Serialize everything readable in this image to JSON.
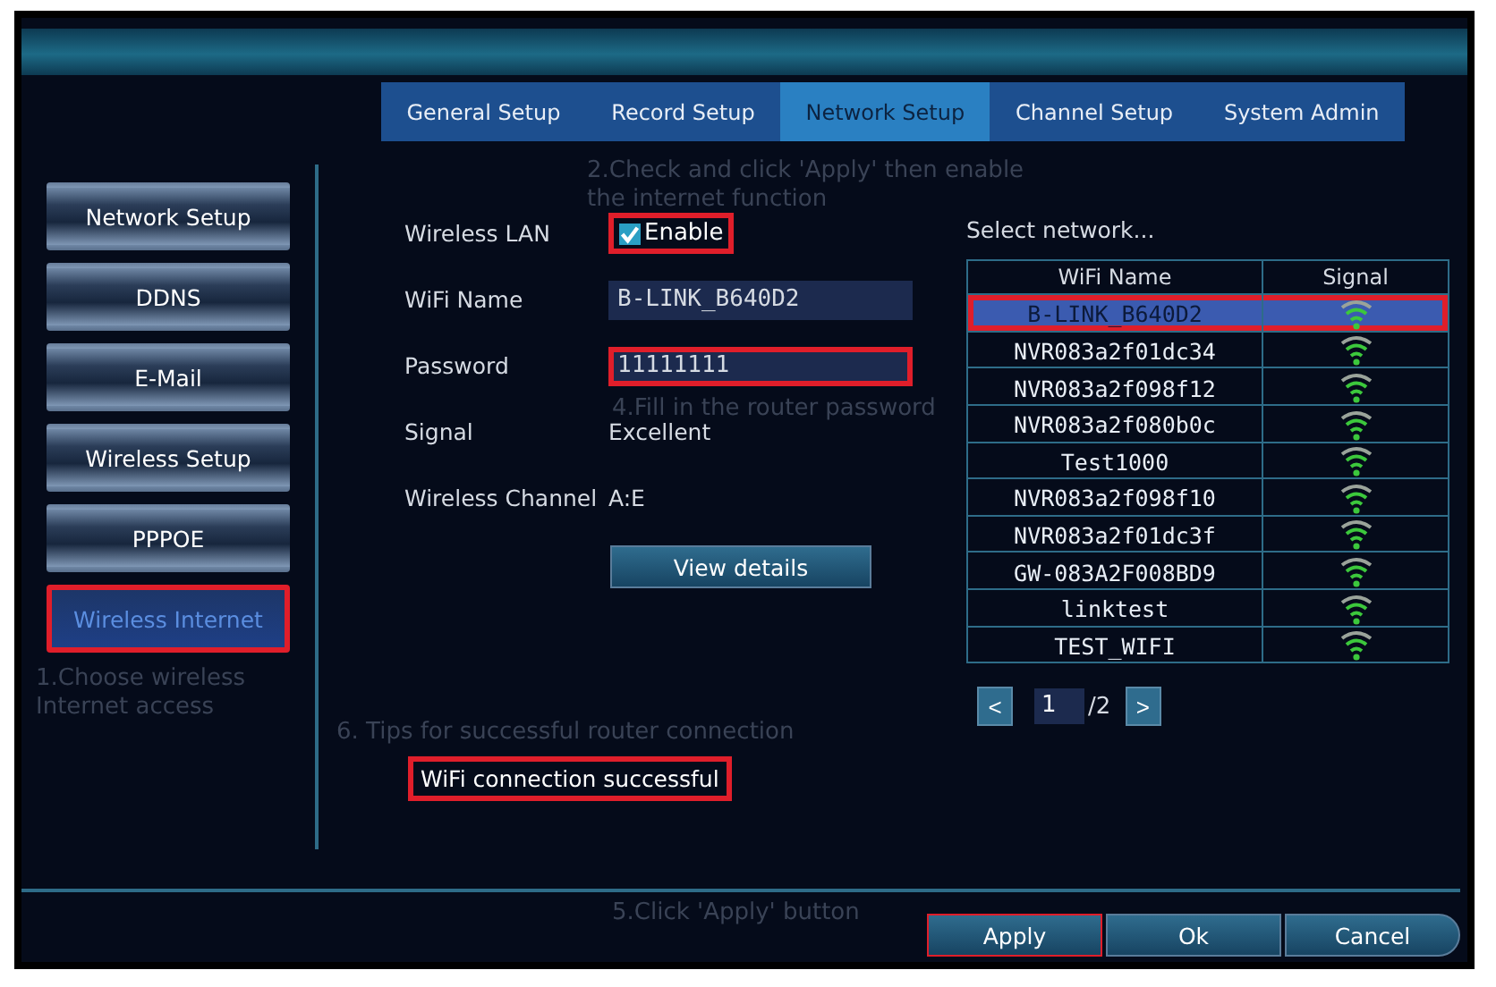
{
  "tabs": [
    {
      "label": "General Setup",
      "selected": false
    },
    {
      "label": "Record Setup",
      "selected": false
    },
    {
      "label": "Network Setup",
      "selected": true
    },
    {
      "label": "Channel Setup",
      "selected": false
    },
    {
      "label": "System Admin",
      "selected": false
    }
  ],
  "sidebar": {
    "items": [
      {
        "label": "Network Setup",
        "selected": false,
        "highlighted": false
      },
      {
        "label": "DDNS",
        "selected": false,
        "highlighted": false
      },
      {
        "label": "E-Mail",
        "selected": false,
        "highlighted": false
      },
      {
        "label": "Wireless Setup",
        "selected": false,
        "highlighted": false
      },
      {
        "label": "PPPOE",
        "selected": false,
        "highlighted": false
      },
      {
        "label": "Wireless Internet",
        "selected": true,
        "highlighted": true
      }
    ]
  },
  "form": {
    "rows": [
      {
        "kind": "checkbox",
        "label": "Wireless LAN",
        "text": "Enable",
        "checked": true,
        "highlighted": true
      },
      {
        "kind": "field",
        "label": "WiFi Name",
        "value": "B-LINK_B640D2",
        "highlighted": false
      },
      {
        "kind": "field",
        "label": "Password",
        "value": "11111111",
        "highlighted": true
      },
      {
        "kind": "text",
        "label": "Signal",
        "value": "Excellent"
      },
      {
        "kind": "text",
        "label": "Wireless Channel",
        "value": "A:E"
      }
    ],
    "details_button": "View details",
    "status": {
      "text": "WiFi connection successful",
      "highlighted": true
    }
  },
  "network_list": {
    "title": "Select network...",
    "columns": [
      "WiFi Name",
      "Signal"
    ],
    "rows": [
      {
        "name": "B-LINK_B640D2",
        "selected": true,
        "highlighted": true
      },
      {
        "name": "NVR083a2f01dc34",
        "selected": false,
        "highlighted": false
      },
      {
        "name": "NVR083a2f098f12",
        "selected": false,
        "highlighted": false
      },
      {
        "name": "NVR083a2f080b0c",
        "selected": false,
        "highlighted": false
      },
      {
        "name": "Test1000",
        "selected": false,
        "highlighted": false
      },
      {
        "name": "NVR083a2f098f10",
        "selected": false,
        "highlighted": false
      },
      {
        "name": "NVR083a2f01dc3f",
        "selected": false,
        "highlighted": false
      },
      {
        "name": "GW-083A2F008BD9",
        "selected": false,
        "highlighted": false
      },
      {
        "name": "linktest",
        "selected": false,
        "highlighted": false
      },
      {
        "name": "TEST_WIFI",
        "selected": false,
        "highlighted": false
      }
    ],
    "pager": {
      "prev": "<",
      "page": "1",
      "total": "/2",
      "next": ">"
    }
  },
  "buttons": [
    {
      "label": "Apply",
      "highlighted": true
    },
    {
      "label": "Ok",
      "highlighted": false
    },
    {
      "label": "Cancel",
      "highlighted": false
    }
  ],
  "annotations": [
    {
      "kind": "step1",
      "text": "1.Choose wireless Internet access"
    },
    {
      "kind": "step2",
      "text": "2.Check and click 'Apply' then enable the internet function"
    },
    {
      "kind": "step4",
      "text": "4.Fill in the router password"
    },
    {
      "kind": "step6",
      "text": "6. Tips for successful router connection"
    },
    {
      "kind": "step5",
      "text": "5.Click 'Apply' button"
    }
  ]
}
